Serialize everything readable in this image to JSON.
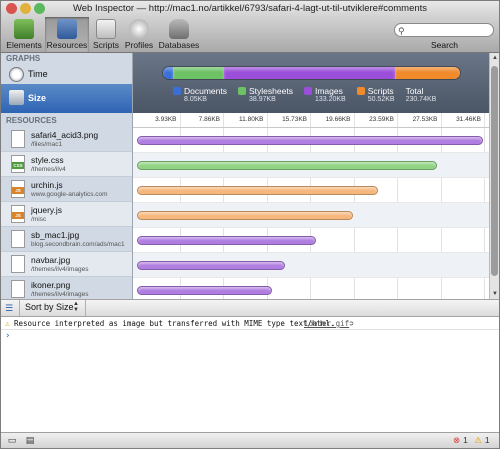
{
  "window": {
    "title": "Web Inspector — http://mac1.no/artikkel/6793/safari-4-lagt-ut-til-utviklere#comments"
  },
  "toolbar": {
    "items": [
      {
        "label": "Elements",
        "icon": "elements-icon"
      },
      {
        "label": "Resources",
        "icon": "resources-icon",
        "active": true
      },
      {
        "label": "Scripts",
        "icon": "scripts-icon"
      },
      {
        "label": "Profiles",
        "icon": "profiles-icon"
      },
      {
        "label": "Databases",
        "icon": "databases-icon"
      }
    ],
    "search_placeholder": "",
    "search_label": "Search"
  },
  "sidebar": {
    "graphs_header": "GRAPHS",
    "graphs": [
      {
        "label": "Time",
        "icon": "clock-icon"
      },
      {
        "label": "Size",
        "icon": "size-icon",
        "selected": true
      }
    ],
    "resources_header": "RESOURCES",
    "resources": [
      {
        "name": "safari4_acid3.png",
        "sub": "/files/mac1",
        "badge": ""
      },
      {
        "name": "style.css",
        "sub": "/themes/ilv4",
        "badge": "CSS"
      },
      {
        "name": "urchin.js",
        "sub": "www.google-analytics.com",
        "badge": "JS"
      },
      {
        "name": "jquery.js",
        "sub": "/misc",
        "badge": "JS"
      },
      {
        "name": "sb_mac1.jpg",
        "sub": "blog.secondbrain.com/ads/mac1",
        "badge": ""
      },
      {
        "name": "navbar.jpg",
        "sub": "/themes/ilv4/images",
        "badge": ""
      },
      {
        "name": "ikoner.png",
        "sub": "/themes/ilv4/images",
        "badge": ""
      }
    ]
  },
  "summary": {
    "segments": [
      {
        "category": "Documents",
        "value": 8.05,
        "color": "#3b6fd8"
      },
      {
        "category": "Stylesheets",
        "value": 38.97,
        "color": "#6cc264"
      },
      {
        "category": "Images",
        "value": 133.2,
        "color": "#9b4ed9"
      },
      {
        "category": "Scripts",
        "value": 50.52,
        "color": "#f08a2a"
      }
    ],
    "legend": [
      {
        "label": "Documents",
        "value": "8.05KB",
        "color": "#3b6fd8"
      },
      {
        "label": "Stylesheets",
        "value": "38.97KB",
        "color": "#6cc264"
      },
      {
        "label": "Images",
        "value": "133.20KB",
        "color": "#9b4ed9"
      },
      {
        "label": "Scripts",
        "value": "50.52KB",
        "color": "#f08a2a"
      },
      {
        "label": "Total",
        "value": "230.74KB",
        "color": ""
      }
    ]
  },
  "chart_data": {
    "type": "bar",
    "orientation": "horizontal",
    "categories": [
      "safari4_acid3.png",
      "style.css",
      "urchin.js",
      "jquery.js",
      "sb_mac1.jpg",
      "navbar.jpg",
      "ikoner.png"
    ],
    "values": [
      31.46,
      27.3,
      22.0,
      19.7,
      16.4,
      13.6,
      12.4
    ],
    "category_colors": [
      "#b07de0",
      "#8fd383",
      "#f6b77c",
      "#f6b77c",
      "#b07de0",
      "#b07de0",
      "#b07de0"
    ],
    "tick_labels": [
      "3.93KB",
      "7.86KB",
      "11.80KB",
      "15.73KB",
      "19.66KB",
      "23.59KB",
      "27.53KB",
      "31.46KB"
    ],
    "xlim": [
      0,
      31.46
    ],
    "unit": "KB"
  },
  "sortbar": {
    "label": "Sort by Size"
  },
  "console": {
    "message": "Resource interpreted as image but transferred with MIME type text/html.",
    "link": "loader.gif",
    "prompt": "›"
  },
  "status": {
    "errors": "1",
    "warnings": "1"
  }
}
